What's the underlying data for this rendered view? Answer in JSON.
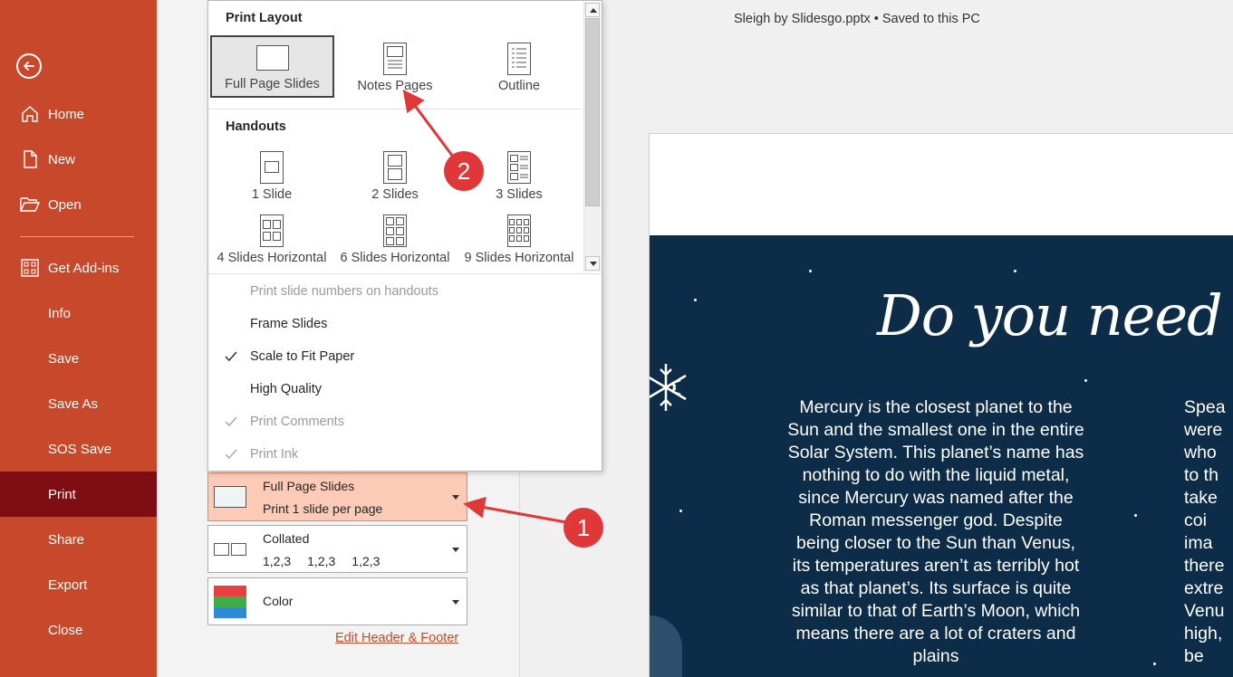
{
  "sidebar": {
    "back_label": "",
    "items": [
      {
        "label": "Home",
        "icon": "home-icon"
      },
      {
        "label": "New",
        "icon": "new-file-icon"
      },
      {
        "label": "Open",
        "icon": "folder-open-icon"
      },
      {
        "label": "Get Add-ins",
        "icon": "add-ins-grid-icon"
      },
      {
        "label": "Info"
      },
      {
        "label": "Save"
      },
      {
        "label": "Save As"
      },
      {
        "label": "SOS Save"
      },
      {
        "label": "Print",
        "active": true
      },
      {
        "label": "Share"
      },
      {
        "label": "Export"
      },
      {
        "label": "Close"
      }
    ],
    "colors": {
      "background": "#c7482b",
      "active": "#7f0e14"
    }
  },
  "file_title": "Sleigh by Slidesgo.pptx  •  Saved to this PC",
  "popup": {
    "print_layout_header": "Print Layout",
    "layouts": [
      "Full Page Slides",
      "Notes Pages",
      "Outline"
    ],
    "selected_layout": "Full Page Slides",
    "handouts_header": "Handouts",
    "handouts": [
      "1 Slide",
      "2 Slides",
      "3 Slides",
      "4 Slides Horizontal",
      "6 Slides Horizontal",
      "9 Slides Horizontal"
    ],
    "options": [
      {
        "label": "Print slide numbers on handouts",
        "checked": false,
        "disabled": true
      },
      {
        "label": "Frame Slides",
        "checked": false,
        "disabled": false
      },
      {
        "label": "Scale to Fit Paper",
        "checked": true,
        "disabled": false
      },
      {
        "label": "High Quality",
        "checked": false,
        "disabled": false
      },
      {
        "label": "Print Comments",
        "checked": true,
        "disabled": true
      },
      {
        "label": "Print Ink",
        "checked": true,
        "disabled": true
      }
    ]
  },
  "settings": {
    "layout_title": "Full Page Slides",
    "layout_sub": "Print 1 slide per page",
    "collate_title": "Collated",
    "collate_nums": [
      "1,2,3",
      "1,2,3",
      "1,2,3"
    ],
    "color_title": "Color",
    "edit_link": "Edit Header & Footer"
  },
  "slide": {
    "title": "Do you need long",
    "body": "Mercury is the closest planet to the Sun and the smallest one in the entire Solar System. This planet’s name has nothing to do with the liquid metal, since Mercury was named after the Roman messenger god. Despite being closer to the Sun than Venus, its temperatures aren’t as terribly hot as that planet’s. Its surface is quite similar to that of Earth’s Moon, which means there are a lot of craters and plains",
    "body_right": "Spea\nwere\nwho \nto th\ntake\ncoi\nima\nthere\nextre\nVenu\nhigh,\nbe",
    "background": "#0d2c48"
  },
  "annotations": [
    "1",
    "2"
  ],
  "accent_color": "#e03838"
}
